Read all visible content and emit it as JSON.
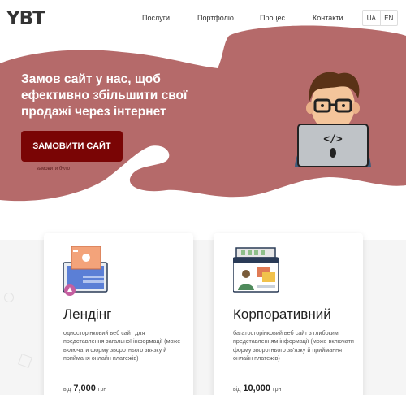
{
  "header": {
    "logo": "YBT",
    "nav": [
      "Послуги",
      "Портфоліо",
      "Процес",
      "Контакти"
    ],
    "lang": [
      "UA",
      "EN"
    ]
  },
  "hero": {
    "title": "Замов сайт у нас, щоб ефективно збільшити свої продажі через інтернет",
    "cta": "ЗАМОВИТИ САЙТ",
    "note": "замовити було",
    "illustration": "developer-at-laptop",
    "colors": {
      "blob": "#b56a6a",
      "button": "#7a0505"
    }
  },
  "services": [
    {
      "icon": "landing-page-icon",
      "title": "Лендінг",
      "description": "односторінковий веб сайт для представлення загальної інформації (може включати форму зворотнього звязку й прийманя онлайн платежів)",
      "price_prefix": "від",
      "price": "7,000",
      "currency": "грн"
    },
    {
      "icon": "corporate-site-icon",
      "title": "Корпоративний",
      "description": "багатосторінковий веб сайт з глибоким представленням інформації (може включати форму зворотнього зв'язку й приймання онлайн платежів)",
      "price_prefix": "від",
      "price": "10,000",
      "currency": "грн"
    }
  ]
}
